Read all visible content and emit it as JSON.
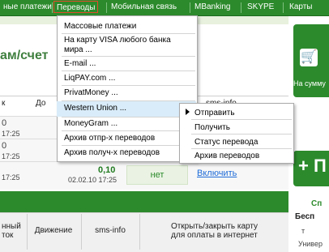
{
  "nav": {
    "items": [
      {
        "label": "ные платежи"
      },
      {
        "label": "Переводы"
      },
      {
        "label": "Мобильная связь"
      },
      {
        "label": "MBanking"
      },
      {
        "label": "SKYPE"
      },
      {
        "label": "Карты"
      }
    ]
  },
  "page": {
    "heading": "ам/счет",
    "headers": {
      "col_k": "к",
      "col_dos": "До",
      "col_sms": "sms-info"
    },
    "rows": [
      {
        "amount": "",
        "date": "17:25"
      },
      {
        "amount": "",
        "date": "17:25"
      },
      {
        "amount": "0,10",
        "date": "02.02.10 17:25"
      }
    ],
    "row0_prefix": "0",
    "row1_prefix": "0",
    "no_button": "нет",
    "enable_link": "Включить",
    "bottom": {
      "col1": "нный\nток",
      "col2": "Движение",
      "col3": "sms-info",
      "col4": "Открыть/закрыть карту\nдля оплаты в интернет"
    }
  },
  "promo": {
    "text": "На сумму",
    "plus_text": "+ П",
    "side_a": "Сп",
    "side_b": "Бесп",
    "side_c": "т",
    "side_d": "Универ"
  },
  "menu": {
    "items": [
      "Массовые платежи",
      "На карту VISA любого банка мира ...",
      "E-mail ...",
      "LiqPAY.com ...",
      "PrivatMoney ...",
      "Western Union ...",
      "MoneyGram ...",
      "Архив отпр-х переводов",
      "Архив получ-х переводов"
    ]
  },
  "submenu": {
    "items": [
      "Отправить",
      "Получить",
      "Статус перевода",
      "Архив переводов"
    ]
  }
}
